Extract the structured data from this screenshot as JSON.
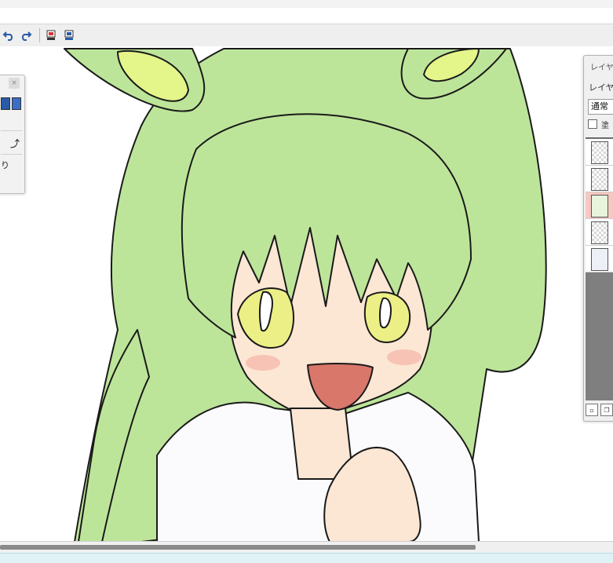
{
  "toolbar": {
    "buttons": [
      "undo-icon",
      "redo-icon",
      "layer-copy-icon",
      "layer-merge-icon"
    ]
  },
  "tool_panel": {
    "close_glyph": "×",
    "item_text": "り"
  },
  "layers_panel": {
    "title": "レイヤ",
    "subtitle": "レイヤ(",
    "blend_mode": "通常",
    "checkbox_label": "塗",
    "selected_layer_index": 2,
    "layer_count": 5
  },
  "colors": {
    "hair": "#bde59a",
    "ear_inner": "#e4f58a",
    "skin": "#fce6d4",
    "eye": "#ecef86",
    "blush": "#f4b3a6",
    "mouth": "#d9776a",
    "selected_layer": "#f6c9c0",
    "layer_list_bg": "#7f7f7f",
    "status_bar": "#dff3f6"
  },
  "canvas": {
    "artwork": "anime-character-illustration"
  }
}
